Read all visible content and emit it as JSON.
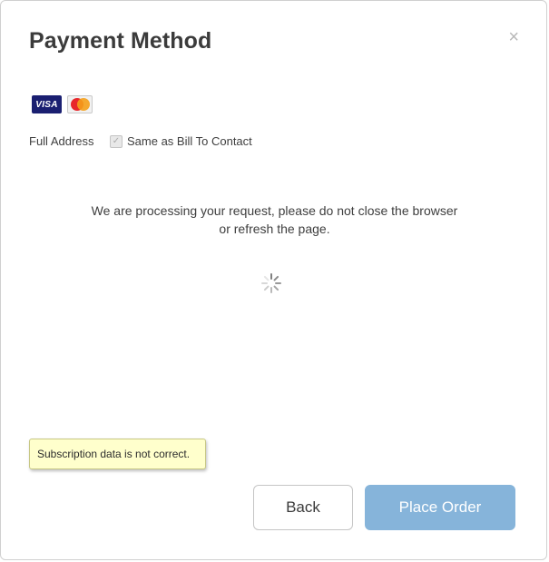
{
  "modal": {
    "title": "Payment Method",
    "close_glyph": "×"
  },
  "cards": {
    "visa_label": "VISA",
    "mastercard_label": "MasterCard"
  },
  "address": {
    "label": "Full Address",
    "checkbox_label": "Same as Bill To Contact",
    "checkbox_checked": true
  },
  "processing": {
    "line1": "We are processing your request, please do not close the browser",
    "line2": "or refresh the page."
  },
  "tooltip": {
    "text": "Subscription data is not correct."
  },
  "buttons": {
    "back_label": "Back",
    "place_order_label": "Place Order"
  },
  "colors": {
    "place_order_bg": "#86b4da",
    "tooltip_bg": "#ffffcc",
    "title_color": "#3b3b3b"
  }
}
